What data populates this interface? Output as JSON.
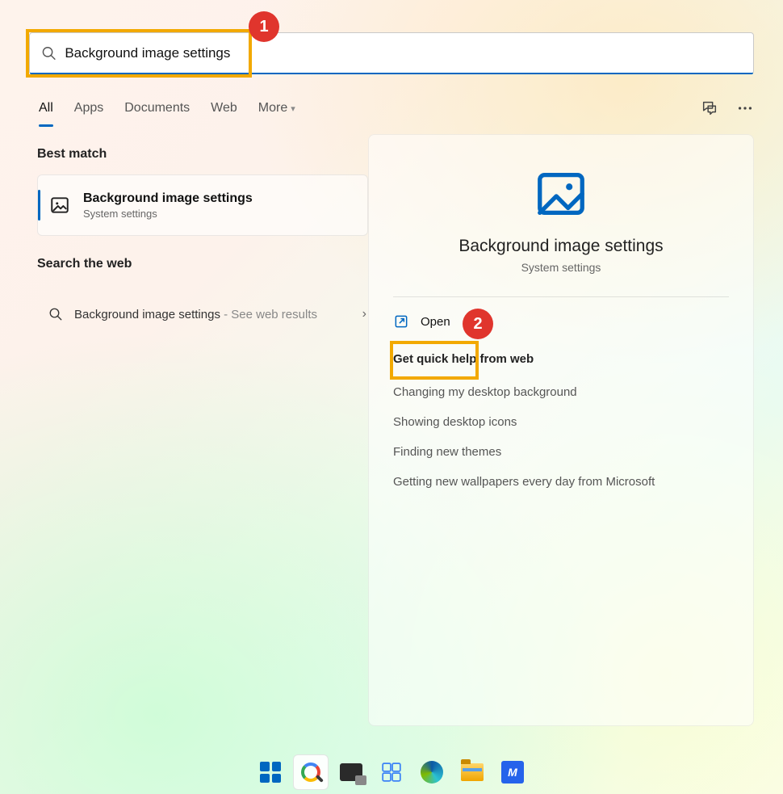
{
  "search": {
    "value": "Background image settings"
  },
  "tabs": {
    "items": [
      "All",
      "Apps",
      "Documents",
      "Web",
      "More"
    ],
    "active_index": 0
  },
  "annotations": {
    "badge1": "1",
    "badge2": "2"
  },
  "left": {
    "best_match_head": "Best match",
    "best_match": {
      "title": "Background image settings",
      "subtitle": "System settings"
    },
    "search_web_head": "Search the web",
    "web_item": {
      "title": "Background image settings",
      "suffix": " - See web results"
    }
  },
  "right": {
    "title": "Background image settings",
    "subtitle": "System settings",
    "open_label": "Open",
    "help_head": "Get quick help from web",
    "help_items": [
      "Changing my desktop background",
      "Showing desktop icons",
      "Finding new themes",
      "Getting new wallpapers every day from Microsoft"
    ]
  },
  "taskbar": {
    "app_letter": "M"
  },
  "colors": {
    "accent": "#0067c0",
    "highlight": "#f2a900",
    "badge": "#e0352d"
  }
}
